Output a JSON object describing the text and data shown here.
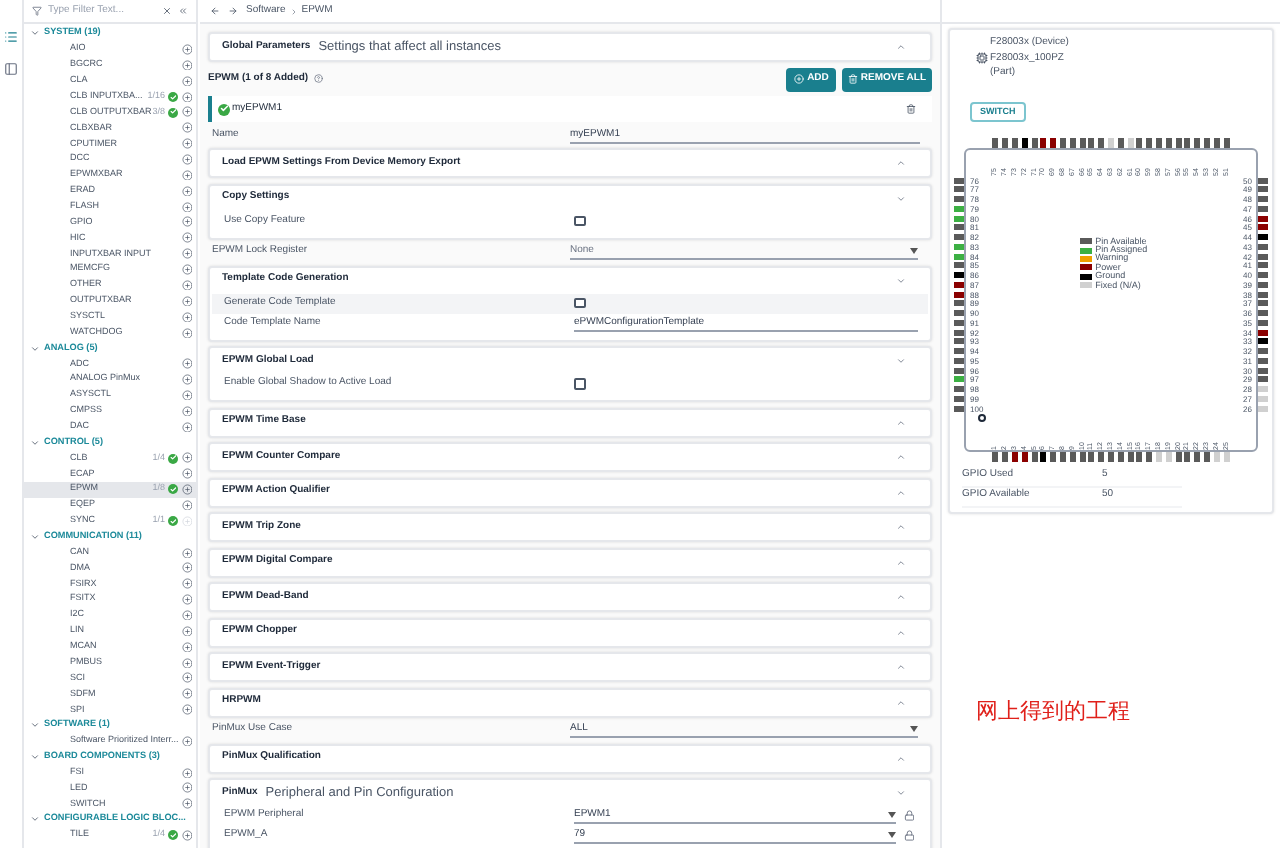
{
  "filter": {
    "placeholder": "Type Filter Text..."
  },
  "sidebar": {
    "categories": [
      {
        "label": "SYSTEM (19)",
        "expanded": true,
        "items": [
          {
            "label": "AIO",
            "added": false,
            "selected": false,
            "disabled": false
          },
          {
            "label": "BGCRC",
            "added": false,
            "selected": false,
            "disabled": false
          },
          {
            "label": "CLA",
            "added": false,
            "selected": false,
            "disabled": false
          },
          {
            "label": "CLB INPUTXBA...",
            "count": "1/16",
            "added": true,
            "selected": false,
            "disabled": false
          },
          {
            "label": "CLB OUTPUTXBAR",
            "count": "3/8",
            "added": true,
            "selected": false,
            "disabled": false
          },
          {
            "label": "CLBXBAR",
            "added": false,
            "selected": false,
            "disabled": false
          },
          {
            "label": "CPUTIMER",
            "added": false,
            "selected": false,
            "disabled": false
          },
          {
            "label": "DCC",
            "added": false,
            "selected": false,
            "disabled": false
          },
          {
            "label": "EPWMXBAR",
            "added": false,
            "selected": false,
            "disabled": false
          },
          {
            "label": "ERAD",
            "added": false,
            "selected": false,
            "disabled": false
          },
          {
            "label": "FLASH",
            "added": false,
            "selected": false,
            "disabled": false
          },
          {
            "label": "GPIO",
            "added": false,
            "selected": false,
            "disabled": false
          },
          {
            "label": "HIC",
            "added": false,
            "selected": false,
            "disabled": false
          },
          {
            "label": "INPUTXBAR INPUT",
            "added": false,
            "selected": false,
            "disabled": false
          },
          {
            "label": "MEMCFG",
            "added": false,
            "selected": false,
            "disabled": false
          },
          {
            "label": "OTHER",
            "added": false,
            "selected": false,
            "disabled": false
          },
          {
            "label": "OUTPUTXBAR",
            "added": false,
            "selected": false,
            "disabled": false
          },
          {
            "label": "SYSCTL",
            "added": false,
            "selected": false,
            "disabled": false
          },
          {
            "label": "WATCHDOG",
            "added": false,
            "selected": false,
            "disabled": false
          }
        ]
      },
      {
        "label": "ANALOG (5)",
        "expanded": true,
        "items": [
          {
            "label": "ADC",
            "added": false,
            "selected": false,
            "disabled": false
          },
          {
            "label": "ANALOG PinMux",
            "added": false,
            "selected": false,
            "disabled": false
          },
          {
            "label": "ASYSCTL",
            "added": false,
            "selected": false,
            "disabled": false
          },
          {
            "label": "CMPSS",
            "added": false,
            "selected": false,
            "disabled": false
          },
          {
            "label": "DAC",
            "added": false,
            "selected": false,
            "disabled": false
          }
        ]
      },
      {
        "label": "CONTROL (5)",
        "expanded": true,
        "items": [
          {
            "label": "CLB",
            "count": "1/4",
            "added": true,
            "selected": false,
            "disabled": false
          },
          {
            "label": "ECAP",
            "added": false,
            "selected": false,
            "disabled": false
          },
          {
            "label": "EPWM",
            "count": "1/8",
            "added": true,
            "selected": true,
            "disabled": false
          },
          {
            "label": "EQEP",
            "added": false,
            "selected": false,
            "disabled": false
          },
          {
            "label": "SYNC",
            "count": "1/1",
            "added": true,
            "selected": false,
            "disabled": true
          }
        ]
      },
      {
        "label": "COMMUNICATION (11)",
        "expanded": true,
        "items": [
          {
            "label": "CAN",
            "added": false,
            "selected": false,
            "disabled": false
          },
          {
            "label": "DMA",
            "added": false,
            "selected": false,
            "disabled": false
          },
          {
            "label": "FSIRX",
            "added": false,
            "selected": false,
            "disabled": false
          },
          {
            "label": "FSITX",
            "added": false,
            "selected": false,
            "disabled": false
          },
          {
            "label": "I2C",
            "added": false,
            "selected": false,
            "disabled": false
          },
          {
            "label": "LIN",
            "added": false,
            "selected": false,
            "disabled": false
          },
          {
            "label": "MCAN",
            "added": false,
            "selected": false,
            "disabled": false
          },
          {
            "label": "PMBUS",
            "added": false,
            "selected": false,
            "disabled": false
          },
          {
            "label": "SCI",
            "added": false,
            "selected": false,
            "disabled": false
          },
          {
            "label": "SDFM",
            "added": false,
            "selected": false,
            "disabled": false
          },
          {
            "label": "SPI",
            "added": false,
            "selected": false,
            "disabled": false
          }
        ]
      },
      {
        "label": "SOFTWARE (1)",
        "expanded": true,
        "items": [
          {
            "label": "Software Prioritized Interr...",
            "added": false,
            "selected": false,
            "disabled": false
          }
        ]
      },
      {
        "label": "BOARD COMPONENTS (3)",
        "expanded": true,
        "items": [
          {
            "label": "FSI",
            "added": false,
            "selected": false,
            "disabled": false
          },
          {
            "label": "LED",
            "added": false,
            "selected": false,
            "disabled": false
          },
          {
            "label": "SWITCH",
            "added": false,
            "selected": false,
            "disabled": false
          }
        ]
      },
      {
        "label": "CONFIGURABLE LOGIC BLOC...",
        "expanded": true,
        "items": [
          {
            "label": "TILE",
            "count": "1/4",
            "added": true,
            "selected": false,
            "disabled": false
          }
        ]
      }
    ]
  },
  "breadcrumb": [
    "Software",
    "EPWM"
  ],
  "global": {
    "title": "Global Parameters",
    "subtitle": "Settings that affect all instances",
    "expanded": false
  },
  "module": {
    "title": "EPWM (1 of 8 Added)",
    "add": "ADD",
    "remove_all": "REMOVE ALL"
  },
  "instance": {
    "name": "myEPWM1",
    "selected": true
  },
  "sections": [
    {
      "kind": "text",
      "label": "Name",
      "value": "myEPWM1"
    },
    {
      "kind": "card",
      "title": "Load EPWM Settings From Device Memory Export",
      "expanded": false
    },
    {
      "kind": "card",
      "title": "Copy Settings",
      "expanded": true,
      "rows": [
        {
          "label": "Use Copy Feature",
          "kind": "checkbox",
          "checked": false,
          "highlighted": false
        }
      ]
    },
    {
      "kind": "select",
      "label": "EPWM Lock Register",
      "placeholder": "None"
    },
    {
      "kind": "card",
      "title": "Template Code Generation",
      "expanded": true,
      "rows": [
        {
          "label": "Generate Code Template",
          "kind": "checkbox",
          "checked": false,
          "highlighted": true
        },
        {
          "label": "Code Template Name",
          "kind": "text",
          "value": "ePWMConfigurationTemplate",
          "highlighted": false
        }
      ]
    },
    {
      "kind": "card",
      "title": "EPWM Global Load",
      "expanded": true,
      "rows": [
        {
          "label": "Enable Global Shadow to Active Load",
          "kind": "checkbox",
          "checked": false,
          "highlighted": false
        }
      ]
    },
    {
      "kind": "card",
      "title": "EPWM Time Base",
      "expanded": false
    },
    {
      "kind": "card",
      "title": "EPWM Counter Compare",
      "expanded": false
    },
    {
      "kind": "card",
      "title": "EPWM Action Qualifier",
      "expanded": false
    },
    {
      "kind": "card",
      "title": "EPWM Trip Zone",
      "expanded": false
    },
    {
      "kind": "card",
      "title": "EPWM Digital Compare",
      "expanded": false
    },
    {
      "kind": "card",
      "title": "EPWM Dead-Band",
      "expanded": false
    },
    {
      "kind": "card",
      "title": "EPWM Chopper",
      "expanded": false
    },
    {
      "kind": "card",
      "title": "EPWM Event-Trigger",
      "expanded": false
    },
    {
      "kind": "card",
      "title": "HRPWM",
      "expanded": false
    },
    {
      "kind": "select",
      "label": "PinMux Use Case",
      "value": "ALL"
    },
    {
      "kind": "card",
      "title": "PinMux Qualification",
      "expanded": false
    },
    {
      "kind": "card",
      "title": "PinMux",
      "subtitle": "Peripheral and Pin Configuration",
      "expanded": true,
      "rows": [
        {
          "label": "EPWM Peripheral",
          "kind": "select",
          "value": "EPWM1",
          "lockable": true,
          "highlighted": false
        },
        {
          "label": "EPWM_A",
          "kind": "select",
          "value": "79",
          "lockable": true,
          "highlighted": false
        }
      ]
    }
  ],
  "device": {
    "device": "F28003x (Device)",
    "part": "F28003x_100PZ",
    "part_note": "(Part)",
    "switch": "SWITCH"
  },
  "chip": {
    "top_pins": [
      {
        "label": "75",
        "color": "#5a5a5a"
      },
      {
        "label": "74",
        "color": "#5a5a5a"
      },
      {
        "label": "73",
        "color": "#5a5a5a"
      },
      {
        "label": "72",
        "color": "#000000"
      },
      {
        "label": "71",
        "color": "#5a5a5a"
      },
      {
        "label": "70",
        "color": "#8b0000"
      },
      {
        "label": "69",
        "color": "#8b0000"
      },
      {
        "label": "68",
        "color": "#5a5a5a"
      },
      {
        "label": "67",
        "color": "#5a5a5a"
      },
      {
        "label": "66",
        "color": "#5a5a5a"
      },
      {
        "label": "65",
        "color": "#5a5a5a"
      },
      {
        "label": "64",
        "color": "#5a5a5a"
      },
      {
        "label": "63",
        "color": "#d0d0d0"
      },
      {
        "label": "62",
        "color": "#5a5a5a"
      },
      {
        "label": "61",
        "color": "#d0d0d0"
      },
      {
        "label": "60",
        "color": "#5a5a5a"
      },
      {
        "label": "59",
        "color": "#5a5a5a"
      },
      {
        "label": "58",
        "color": "#5a5a5a"
      },
      {
        "label": "57",
        "color": "#5a5a5a"
      },
      {
        "label": "56",
        "color": "#5a5a5a"
      },
      {
        "label": "55",
        "color": "#5a5a5a"
      },
      {
        "label": "54",
        "color": "#5a5a5a"
      },
      {
        "label": "53",
        "color": "#5a5a5a"
      },
      {
        "label": "52",
        "color": "#5a5a5a"
      },
      {
        "label": "51",
        "color": "#5a5a5a"
      }
    ],
    "left_pins": [
      {
        "label": "76",
        "color": "#5a5a5a"
      },
      {
        "label": "77",
        "color": "#5a5a5a"
      },
      {
        "label": "78",
        "color": "#5a5a5a"
      },
      {
        "label": "79",
        "color": "#3cb043"
      },
      {
        "label": "80",
        "color": "#3cb043"
      },
      {
        "label": "81",
        "color": "#5a5a5a"
      },
      {
        "label": "82",
        "color": "#5a5a5a"
      },
      {
        "label": "83",
        "color": "#3cb043"
      },
      {
        "label": "84",
        "color": "#3cb043"
      },
      {
        "label": "85",
        "color": "#5a5a5a"
      },
      {
        "label": "86",
        "color": "#000000"
      },
      {
        "label": "87",
        "color": "#8b0000"
      },
      {
        "label": "88",
        "color": "#8b0000"
      },
      {
        "label": "89",
        "color": "#5a5a5a"
      },
      {
        "label": "90",
        "color": "#5a5a5a"
      },
      {
        "label": "91",
        "color": "#5a5a5a"
      },
      {
        "label": "92",
        "color": "#5a5a5a"
      },
      {
        "label": "93",
        "color": "#5a5a5a"
      },
      {
        "label": "94",
        "color": "#5a5a5a"
      },
      {
        "label": "95",
        "color": "#5a5a5a"
      },
      {
        "label": "96",
        "color": "#5a5a5a"
      },
      {
        "label": "97",
        "color": "#3cb043"
      },
      {
        "label": "98",
        "color": "#5a5a5a"
      },
      {
        "label": "99",
        "color": "#5a5a5a"
      },
      {
        "label": "100",
        "color": "#5a5a5a"
      }
    ],
    "right_pins": [
      {
        "label": "50",
        "color": "#5a5a5a"
      },
      {
        "label": "49",
        "color": "#5a5a5a"
      },
      {
        "label": "48",
        "color": "#5a5a5a"
      },
      {
        "label": "47",
        "color": "#5a5a5a"
      },
      {
        "label": "46",
        "color": "#8b0000"
      },
      {
        "label": "45",
        "color": "#8b0000"
      },
      {
        "label": "44",
        "color": "#000000"
      },
      {
        "label": "43",
        "color": "#5a5a5a"
      },
      {
        "label": "42",
        "color": "#5a5a5a"
      },
      {
        "label": "41",
        "color": "#5a5a5a"
      },
      {
        "label": "40",
        "color": "#5a5a5a"
      },
      {
        "label": "39",
        "color": "#5a5a5a"
      },
      {
        "label": "38",
        "color": "#5a5a5a"
      },
      {
        "label": "37",
        "color": "#5a5a5a"
      },
      {
        "label": "36",
        "color": "#5a5a5a"
      },
      {
        "label": "35",
        "color": "#5a5a5a"
      },
      {
        "label": "34",
        "color": "#8b0000"
      },
      {
        "label": "33",
        "color": "#000000"
      },
      {
        "label": "32",
        "color": "#5a5a5a"
      },
      {
        "label": "31",
        "color": "#5a5a5a"
      },
      {
        "label": "30",
        "color": "#5a5a5a"
      },
      {
        "label": "29",
        "color": "#5a5a5a"
      },
      {
        "label": "28",
        "color": "#d0d0d0"
      },
      {
        "label": "27",
        "color": "#d0d0d0"
      },
      {
        "label": "26",
        "color": "#d0d0d0"
      }
    ],
    "bottom_pins": [
      {
        "label": "1",
        "color": "#5a5a5a"
      },
      {
        "label": "2",
        "color": "#5a5a5a"
      },
      {
        "label": "3",
        "color": "#8b0000"
      },
      {
        "label": "4",
        "color": "#8b0000"
      },
      {
        "label": "5",
        "color": "#5a5a5a"
      },
      {
        "label": "6",
        "color": "#000000"
      },
      {
        "label": "7",
        "color": "#5a5a5a"
      },
      {
        "label": "8",
        "color": "#5a5a5a"
      },
      {
        "label": "9",
        "color": "#5a5a5a"
      },
      {
        "label": "10",
        "color": "#5a5a5a"
      },
      {
        "label": "11",
        "color": "#5a5a5a"
      },
      {
        "label": "12",
        "color": "#5a5a5a"
      },
      {
        "label": "13",
        "color": "#5a5a5a"
      },
      {
        "label": "14",
        "color": "#5a5a5a"
      },
      {
        "label": "15",
        "color": "#5a5a5a"
      },
      {
        "label": "16",
        "color": "#5a5a5a"
      },
      {
        "label": "17",
        "color": "#5a5a5a"
      },
      {
        "label": "18",
        "color": "#d0d0d0"
      },
      {
        "label": "19",
        "color": "#d0d0d0"
      },
      {
        "label": "20",
        "color": "#5a5a5a"
      },
      {
        "label": "21",
        "color": "#5a5a5a"
      },
      {
        "label": "22",
        "color": "#5a5a5a"
      },
      {
        "label": "23",
        "color": "#5a5a5a"
      },
      {
        "label": "24",
        "color": "#d0d0d0"
      },
      {
        "label": "25",
        "color": "#d0d0d0"
      }
    ],
    "legend": [
      {
        "label": "Pin Available",
        "color": "#5a5a5a"
      },
      {
        "label": "Pin Assigned",
        "color": "#3cb043"
      },
      {
        "label": "Warning",
        "color": "#f0a000"
      },
      {
        "label": "Power",
        "color": "#8b0000"
      },
      {
        "label": "Ground",
        "color": "#000000"
      },
      {
        "label": "Fixed (N/A)",
        "color": "#d0d0d0"
      }
    ]
  },
  "gpio": [
    {
      "label": "GPIO Used",
      "value": "5"
    },
    {
      "label": "GPIO Available",
      "value": "50"
    }
  ],
  "annotation": "网上得到的工程"
}
